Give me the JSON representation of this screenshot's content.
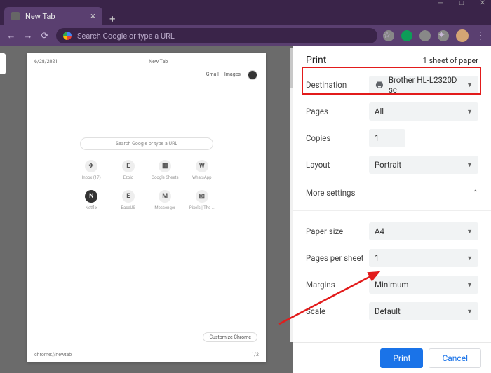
{
  "window": {
    "tab_title": "New Tab",
    "omnibox_placeholder": "Search Google or type a URL"
  },
  "preview": {
    "date": "6/28/2021",
    "title": "New Tab",
    "links": {
      "gmail": "Gmail",
      "images": "Images"
    },
    "search_placeholder": "Search Google or type a URL",
    "shortcuts_row1": [
      {
        "label": "Inbox (17)",
        "glyph": "✈"
      },
      {
        "label": "Ezoic",
        "glyph": "E"
      },
      {
        "label": "Google Sheets",
        "glyph": "▦"
      },
      {
        "label": "WhatsApp",
        "glyph": "W"
      }
    ],
    "shortcuts_row2": [
      {
        "label": "Netflix",
        "glyph": "N"
      },
      {
        "label": "EaseUS",
        "glyph": "E"
      },
      {
        "label": "Messenger",
        "glyph": "M"
      },
      {
        "label": "Pixels | The …",
        "glyph": "▧"
      }
    ],
    "customize": "Customize Chrome",
    "footer_url": "chrome://newtab",
    "footer_page": "1/2"
  },
  "print": {
    "title": "Print",
    "sheets": "1 sheet of paper",
    "labels": {
      "destination": "Destination",
      "pages": "Pages",
      "copies": "Copies",
      "layout": "Layout",
      "more": "More settings",
      "paper_size": "Paper size",
      "pages_per_sheet": "Pages per sheet",
      "margins": "Margins",
      "scale": "Scale"
    },
    "values": {
      "destination": "Brother HL-L2320D se",
      "pages": "All",
      "copies": "1",
      "layout": "Portrait",
      "paper_size": "A4",
      "pages_per_sheet": "1",
      "margins": "Minimum",
      "scale": "Default"
    },
    "buttons": {
      "print": "Print",
      "cancel": "Cancel"
    }
  }
}
